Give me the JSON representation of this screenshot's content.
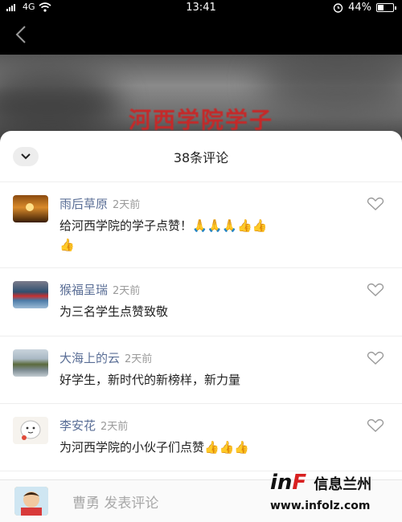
{
  "status_bar": {
    "signal": "4G",
    "time": "13:41",
    "battery": "44%",
    "battery_level": 0.44
  },
  "video": {
    "title": "河西学院学子"
  },
  "comments_panel": {
    "title": "38条评论",
    "comments": [
      {
        "user": "雨后草原",
        "time": "2天前",
        "text": "给河西学院的学子点赞！🙏🙏🙏👍👍",
        "text2": "👍"
      },
      {
        "user": "猴福呈瑞",
        "time": "2天前",
        "text": "为三名学生点赞致敬"
      },
      {
        "user": "大海上的云",
        "time": "2天前",
        "text": "好学生，新时代的新榜样，新力量"
      },
      {
        "user": "李安花",
        "time": "2天前",
        "text": "为河西学院的小伙子们点赞👍👍👍"
      }
    ]
  },
  "input_bar": {
    "placeholder": "曹勇 发表评论"
  },
  "watermark": {
    "logo_in": "in",
    "logo_f": "F",
    "logo_cn": "信息兰州",
    "url": "www.infolz.com"
  },
  "icons": {
    "back": "chevron-left-icon",
    "collapse": "chevron-down-icon",
    "like": "heart-outline-icon",
    "alarm": "alarm-icon",
    "wifi": "wifi-icon"
  }
}
